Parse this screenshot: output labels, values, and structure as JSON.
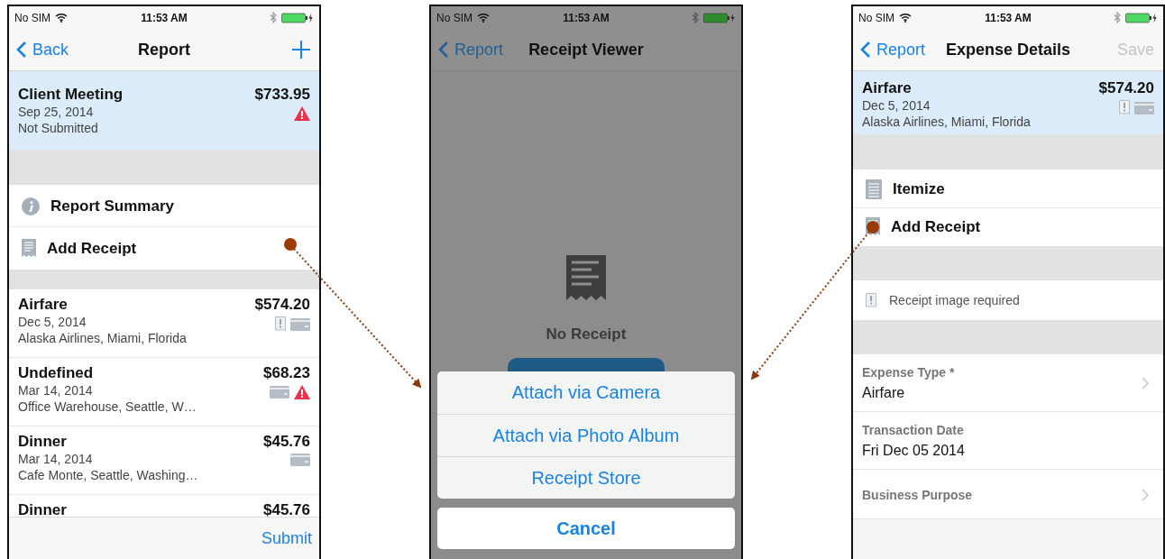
{
  "report_screen": {
    "status_bar": {
      "carrier": "No SIM",
      "time": "11:53 AM"
    },
    "nav": {
      "back": "Back",
      "title": "Report"
    },
    "header": {
      "title": "Client Meeting",
      "amount": "$733.95",
      "lines": [
        "Sep 25, 2014",
        "Not Submitted"
      ],
      "flags": [
        {
          "kind": "warning"
        }
      ]
    },
    "menu": [
      {
        "label": "Report Summary"
      },
      {
        "label": "Add Receipt"
      }
    ],
    "expenses": [
      {
        "title": "Airfare",
        "amount": "$574.20",
        "date": "Dec 5, 2014",
        "location": "Alaska Airlines, Miami, Florida",
        "flags": [
          {
            "kind": "receipt"
          },
          {
            "kind": "card"
          }
        ]
      },
      {
        "title": "Undefined",
        "amount": "$68.23",
        "date": "Mar 14, 2014",
        "location": "Office Warehouse, Seattle, W…",
        "flags": [
          {
            "kind": "card"
          },
          {
            "kind": "warning"
          }
        ]
      },
      {
        "title": "Dinner",
        "amount": "$45.76",
        "date": "Mar 14, 2014",
        "location": "Cafe Monte, Seattle, Washing…",
        "flags": [
          {
            "kind": "card"
          }
        ]
      },
      {
        "title": "Dinner",
        "amount": "$45.76"
      }
    ],
    "toolbar": {
      "action": "Submit"
    }
  },
  "receipt_viewer": {
    "status_bar": {
      "carrier": "No SIM",
      "time": "11:53 AM"
    },
    "nav": {
      "back": "Report",
      "title": "Receipt Viewer"
    },
    "empty_text": "No Receipt",
    "action_sheet": {
      "options": [
        "Attach via Camera",
        "Attach via Photo Album",
        "Receipt Store"
      ],
      "cancel": "Cancel"
    }
  },
  "expense_details": {
    "status_bar": {
      "carrier": "No SIM",
      "time": "11:53 AM"
    },
    "nav": {
      "back": "Report",
      "title": "Expense Details",
      "save": {
        "label": "Save",
        "disabled": true
      }
    },
    "header": {
      "title": "Airfare",
      "amount": "$574.20",
      "lines": [
        "Dec 5, 2014",
        "Alaska Airlines, Miami, Florida"
      ],
      "flags": [
        {
          "kind": "receipt"
        },
        {
          "kind": "card"
        }
      ]
    },
    "menu": [
      {
        "label": "Itemize"
      },
      {
        "label": "Add Receipt"
      }
    ],
    "notice": {
      "text": "Receipt image required"
    },
    "fields": [
      {
        "label": "Expense Type *",
        "value": "Airfare",
        "chevron": true
      },
      {
        "label": "Transaction Date",
        "value": "Fri Dec 05 2014",
        "chevron": false
      },
      {
        "label": "Business Purpose",
        "chevron": true
      }
    ]
  }
}
